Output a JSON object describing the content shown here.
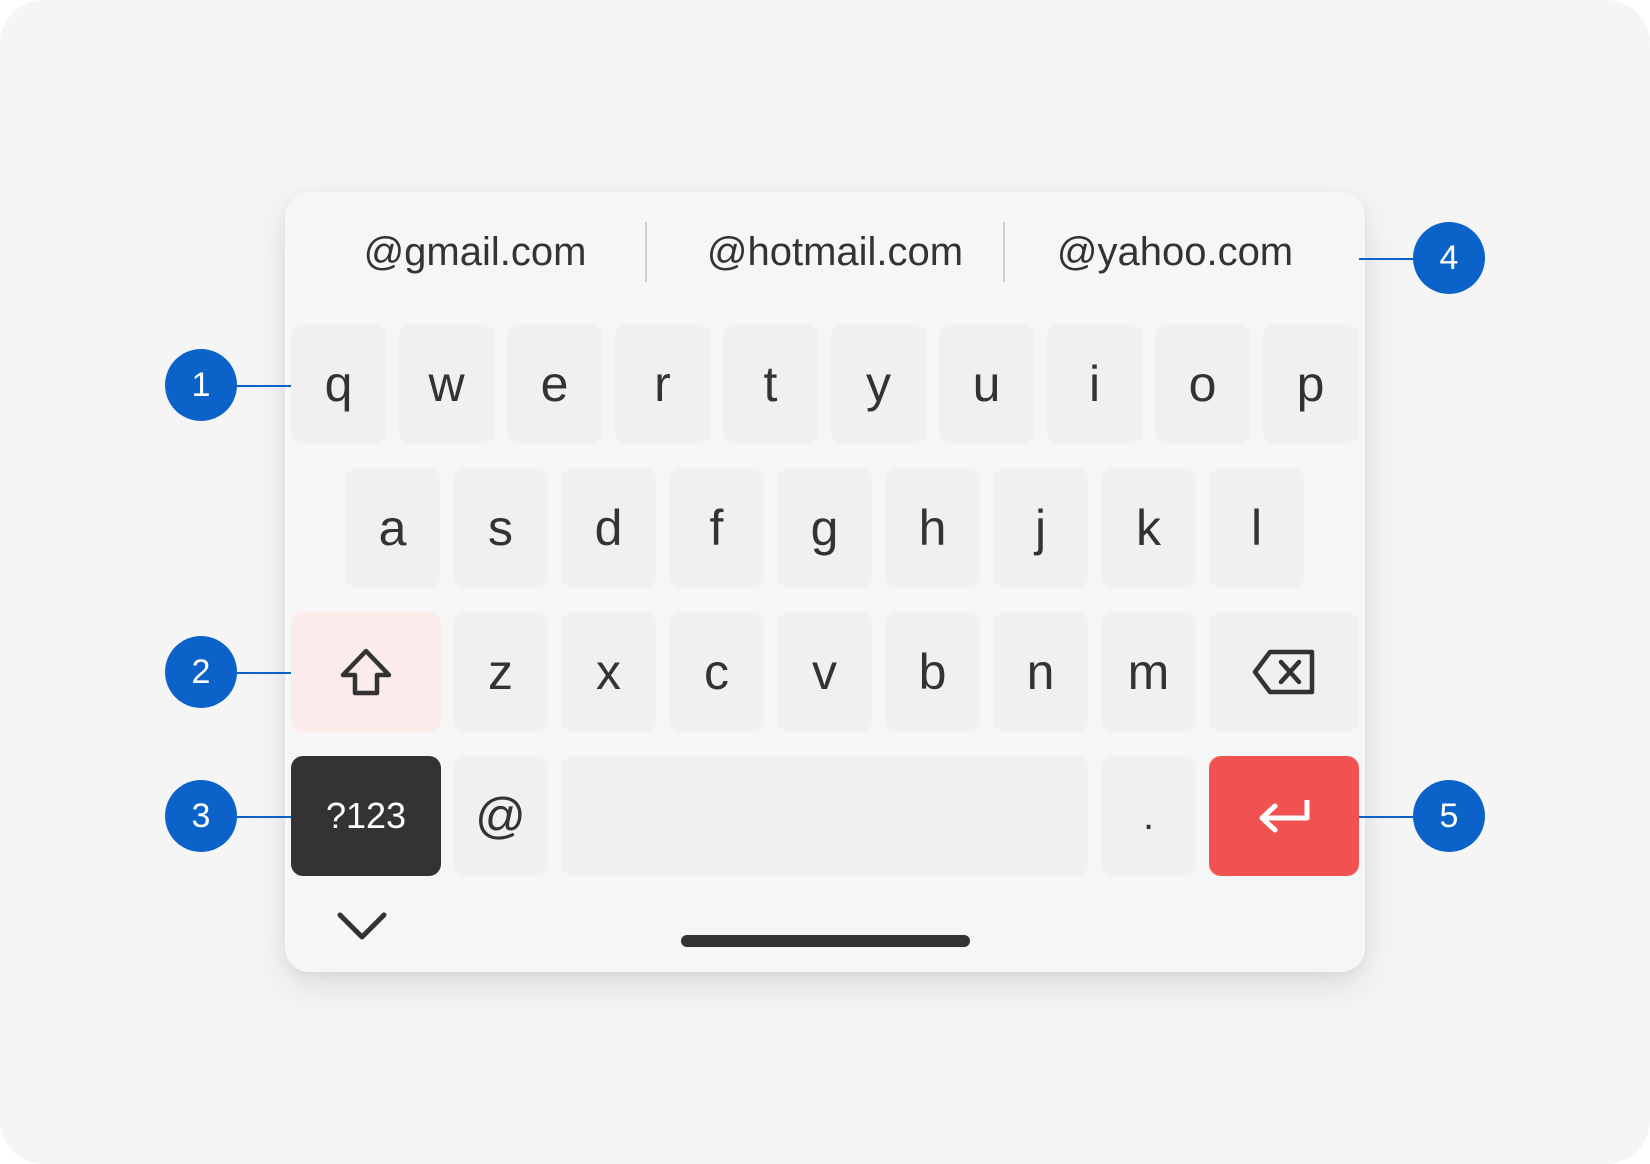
{
  "suggestions": [
    "@gmail.com",
    "@hotmail.com",
    "@yahoo.com"
  ],
  "rows": {
    "row1": [
      "q",
      "w",
      "e",
      "r",
      "t",
      "y",
      "u",
      "i",
      "o",
      "p"
    ],
    "row2": [
      "a",
      "s",
      "d",
      "f",
      "g",
      "h",
      "j",
      "k",
      "l"
    ],
    "row3": [
      "z",
      "x",
      "c",
      "v",
      "b",
      "n",
      "m"
    ]
  },
  "bottom_row": {
    "symbols_label": "?123",
    "at_label": "@",
    "period_label": "."
  },
  "icons": {
    "shift": "shift-arrow-up-icon",
    "backspace": "backspace-icon",
    "enter": "enter-return-icon",
    "collapse": "chevron-down-icon"
  },
  "callouts": [
    "1",
    "2",
    "3",
    "4",
    "5"
  ],
  "colors": {
    "callout": "#0b63c9",
    "enter_key": "#f05252",
    "shift_key": "#fcebeb",
    "symbols_key": "#333333",
    "key": "#f0f0f0"
  }
}
